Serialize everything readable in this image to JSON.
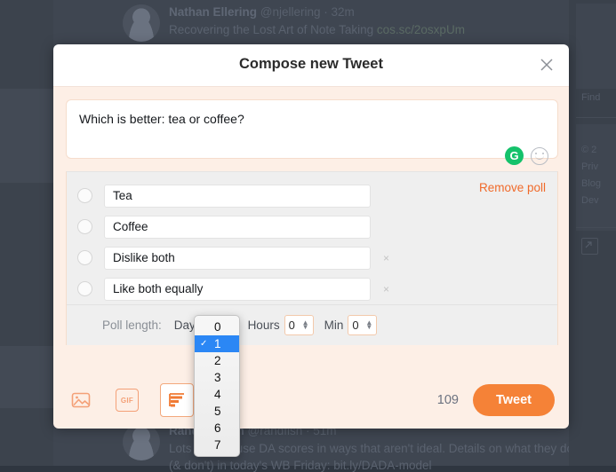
{
  "background": {
    "tweets": [
      {
        "name": "Nathan Ellering",
        "handle": "@njellering",
        "time": "· 32m",
        "body": "Recovering the Lost Art of Note Taking",
        "link": "cos.sc/2osxpUm",
        "body2": ""
      },
      {
        "name": "Rand Fishkin",
        "handle": "@randfish",
        "time": "· 51m",
        "body": "Lots of folks use DA scores in ways that aren't ideal. Details on what they do",
        "link": "",
        "body2": "(& don't) in today's WB Friday: bit.ly/DADA-model"
      }
    ],
    "right_panel": {
      "find_label": "Find",
      "footer": [
        "© 2",
        "Priv",
        "Blog",
        "Dev"
      ]
    }
  },
  "modal": {
    "title": "Compose new Tweet",
    "close_icon": "close-icon",
    "compose": {
      "text": "Which is better: tea or coffee?",
      "grammarly_label": "G",
      "emoji_icon": "emoji-smiley-icon"
    },
    "poll": {
      "remove_label": "Remove poll",
      "options": [
        {
          "value": "Tea",
          "removable": false
        },
        {
          "value": "Coffee",
          "removable": false
        },
        {
          "value": "Dislike both",
          "removable": true
        },
        {
          "value": "Like both equally",
          "removable": true
        }
      ],
      "remove_option_icon": "×",
      "length": {
        "label": "Poll length:",
        "days_label": "Days",
        "days_value": "1",
        "hours_label": "Hours",
        "hours_value": "0",
        "min_label": "Min",
        "min_value": "0"
      }
    },
    "dropdown": {
      "open": true,
      "selected": "1",
      "check_glyph": "✓",
      "options": [
        "0",
        "1",
        "2",
        "3",
        "4",
        "5",
        "6",
        "7"
      ]
    },
    "toolbar": {
      "image_icon": "image-icon",
      "gif_label": "GIF",
      "poll_icon": "poll-icon",
      "char_count": "109",
      "tweet_label": "Tweet"
    }
  },
  "colors": {
    "accent_orange": "#f58237",
    "modal_body": "#fdefe6",
    "remove_poll": "#f06a2a",
    "select_blue": "#2b87f5",
    "grammarly_green": "#15c26b"
  }
}
